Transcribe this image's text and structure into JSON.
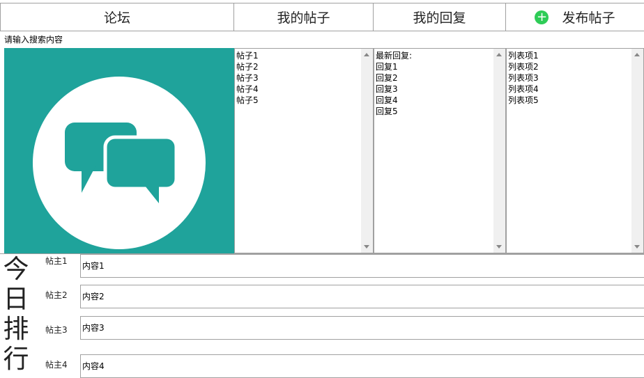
{
  "tabs": {
    "forum": "论坛",
    "my_posts": "我的帖子",
    "my_replies": "我的回复",
    "new_post": "发布帖子",
    "new_post_icon": "plus-circle-icon"
  },
  "search": {
    "placeholder": "请输入搜索内容"
  },
  "logo": {
    "icon": "chat-bubbles-icon",
    "background": "#1fa39b"
  },
  "posts_list": [
    "帖子1",
    "帖子2",
    "帖子3",
    "帖子4",
    "帖子5"
  ],
  "replies_list": [
    "最新回复:",
    "回复1",
    "回复2",
    "回复3",
    "回复4",
    "回复5"
  ],
  "items_list": [
    "列表项1",
    "列表项2",
    "列表项3",
    "列表项4",
    "列表项5"
  ],
  "ranking": {
    "title_chars": [
      "今",
      "日",
      "排",
      "行"
    ],
    "rows": [
      {
        "author": "帖主1",
        "content": "内容1"
      },
      {
        "author": "帖主2",
        "content": "内容2"
      },
      {
        "author": "帖主3",
        "content": "内容3"
      },
      {
        "author": "帖主4",
        "content": "内容4"
      }
    ]
  },
  "colors": {
    "accent": "#1fa39b",
    "add_button": "#2ecc57"
  }
}
